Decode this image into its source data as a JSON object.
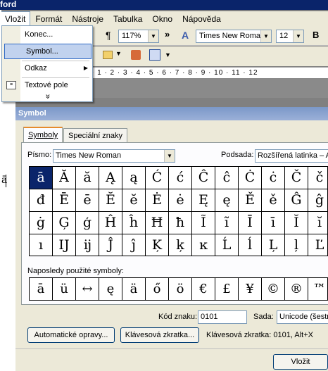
{
  "window": {
    "title": "ford"
  },
  "menubar": {
    "items": [
      "Vložit",
      "Formát",
      "Nástroje",
      "Tabulka",
      "Okno",
      "Nápověda"
    ]
  },
  "toolbar": {
    "pilcrow": "¶",
    "zoom": "117%",
    "overflow": "»",
    "font_name": "Times New Roman",
    "font_size": "12",
    "bold": "B"
  },
  "ruler": {
    "text": "· 1 · 2 · 3 · 4 · 5 · 6 · 7 · 8 · 9 · 10 · 11 · 12"
  },
  "insert_menu": {
    "items": [
      "Konec...",
      "Symbol...",
      "Odkaz",
      "Textové pole"
    ],
    "expand": "»"
  },
  "document": {
    "cursor_text": "ā"
  },
  "dialog": {
    "title": "Symbol",
    "tabs": [
      "Symboly",
      "Speciální znaky"
    ],
    "font_label": "Písmo:",
    "font_value": "Times New Roman",
    "subset_label": "Podsada:",
    "subset_value": "Rozšířená latinka – A",
    "symbols": [
      [
        "ā",
        "Ă",
        "ă",
        "Ą",
        "ą",
        "Ć",
        "ć",
        "Ĉ",
        "ĉ",
        "Ċ",
        "ċ",
        "Č",
        "č",
        "Ď"
      ],
      [
        "đ",
        "Ē",
        "ē",
        "Ĕ",
        "ĕ",
        "Ė",
        "ė",
        "Ę",
        "ę",
        "Ě",
        "ě",
        "Ĝ",
        "ĝ",
        "Ğ"
      ],
      [
        "ġ",
        "Ģ",
        "ģ",
        "Ĥ",
        "ĥ",
        "Ħ",
        "ħ",
        "Ĩ",
        "ĩ",
        "Ī",
        "ī",
        "Ĭ",
        "ĭ",
        "Į"
      ],
      [
        "ı",
        "Ĳ",
        "ĳ",
        "Ĵ",
        "ĵ",
        "Ķ",
        "ķ",
        "ĸ",
        "Ĺ",
        "ĺ",
        "Ļ",
        "ļ",
        "Ľ",
        "ľ"
      ]
    ],
    "recent_label": "Naposledy použité symboly:",
    "recent": [
      "ā",
      "ü",
      "↔",
      "ę",
      "ä",
      "ő",
      "ö",
      "€",
      "£",
      "¥",
      "©",
      "®",
      "™",
      "±"
    ],
    "code_label": "Kód znaku:",
    "code_value": "0101",
    "set_label": "Sada:",
    "set_value": "Unicode (šestn",
    "autocorrect_button": "Automatické opravy...",
    "shortcut_button": "Klávesová zkratka...",
    "shortcut_text": "Klávesová zkratka: 0101, Alt+X",
    "insert_button": "Vložit"
  }
}
